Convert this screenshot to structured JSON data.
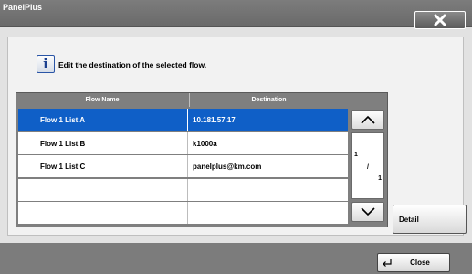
{
  "window": {
    "title": "PanelPlus",
    "close_icon": "close-x-icon"
  },
  "info": {
    "icon": "info-icon",
    "glyph": "i",
    "message": "Edit the destination of the selected flow."
  },
  "table": {
    "headers": {
      "name": "Flow Name",
      "destination": "Destination"
    },
    "rows": [
      {
        "name": "Flow 1 List A",
        "destination": "10.181.57.17",
        "selected": true
      },
      {
        "name": "Flow 1 List B",
        "destination": "k1000a",
        "selected": false
      },
      {
        "name": "Flow 1 List C",
        "destination": "panelplus@km.com",
        "selected": false
      },
      {
        "name": "",
        "destination": "",
        "selected": false
      },
      {
        "name": "",
        "destination": "",
        "selected": false
      }
    ]
  },
  "pager": {
    "current": "1",
    "separator": "/",
    "total": "1",
    "up_icon": "chevron-up-icon",
    "down_icon": "chevron-down-icon"
  },
  "buttons": {
    "detail": "Detail",
    "close": "Close",
    "enter_icon": "enter-arrow-icon"
  },
  "colors": {
    "selection": "#0f5fc7",
    "titlebar": "#6e6e6e",
    "background": "#e2e2e2"
  }
}
